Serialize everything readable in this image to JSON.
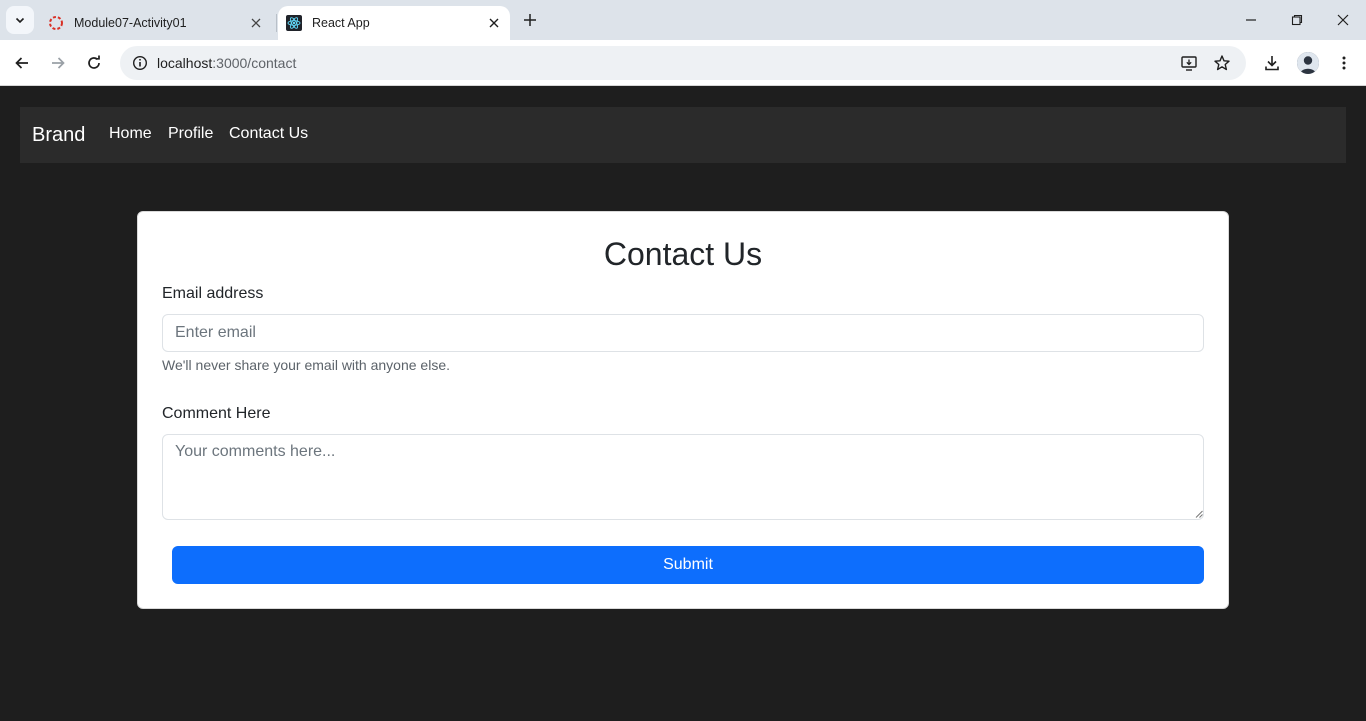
{
  "browser": {
    "tabs": [
      {
        "title": "Module07-Activity01",
        "active": false
      },
      {
        "title": "React App",
        "active": true
      }
    ],
    "url_host": "localhost",
    "url_path": ":3000/contact"
  },
  "navbar": {
    "brand": "Brand",
    "links": [
      {
        "label": "Home"
      },
      {
        "label": "Profile"
      },
      {
        "label": "Contact Us"
      }
    ]
  },
  "form": {
    "title": "Contact Us",
    "email_label": "Email address",
    "email_placeholder": "Enter email",
    "email_value": "",
    "email_help": "We'll never share your email with anyone else.",
    "comment_label": "Comment Here",
    "comment_placeholder": "Your comments here...",
    "comment_value": "",
    "submit_label": "Submit"
  },
  "colors": {
    "page_background": "#1e1e1e",
    "navbar_background": "#2b2b2b",
    "primary_button": "#0d6efd"
  }
}
